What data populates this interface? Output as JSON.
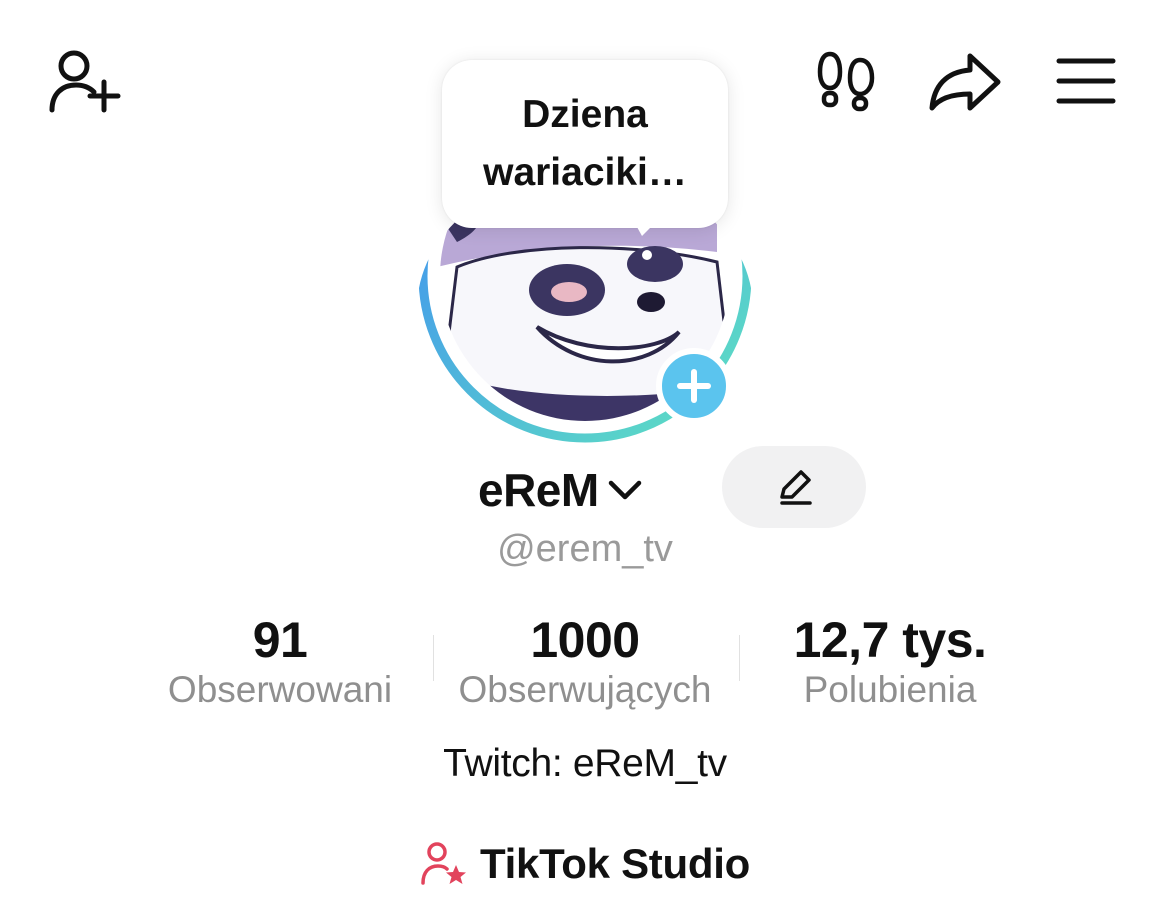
{
  "header": {
    "icons": [
      "add-friend-icon",
      "footprints-icon",
      "share-icon",
      "menu-icon"
    ]
  },
  "avatar": {
    "note": "Dziena wariaciki…"
  },
  "profile": {
    "display_name": "eReM",
    "username": "@erem_tv",
    "bio": "Twitch: eReM_tv"
  },
  "stats": [
    {
      "value": "91",
      "label": "Obserwowani"
    },
    {
      "value": "1000",
      "label": "Obserwujących"
    },
    {
      "value": "12,7 tys.",
      "label": "Polubienia"
    }
  ],
  "studio": {
    "label": "TikTok Studio"
  },
  "colors": {
    "accent_blue": "#5bc4ee",
    "ring_start": "#3f8cf3",
    "ring_end": "#5fe3c0",
    "studio_icon": "#e2435c",
    "muted_text": "#9a9a9a"
  }
}
